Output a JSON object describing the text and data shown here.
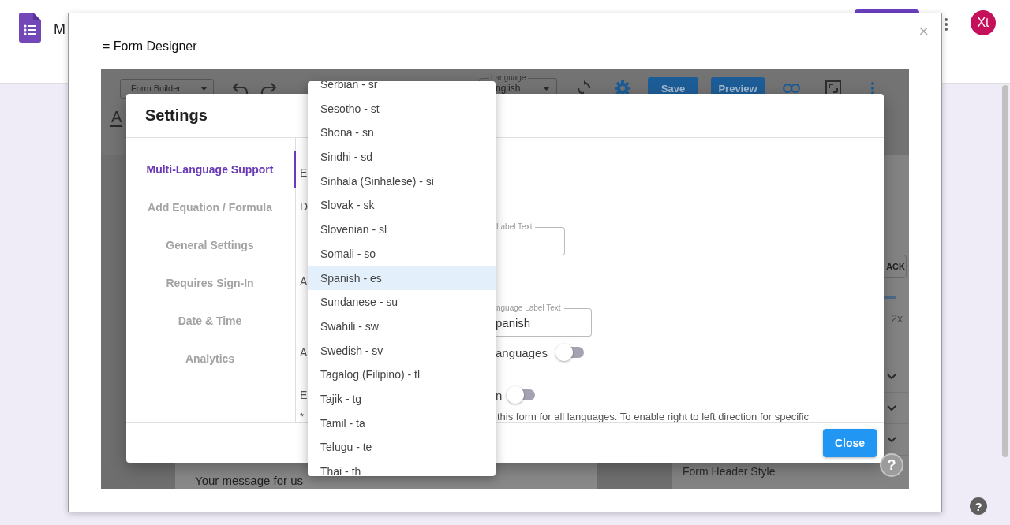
{
  "app_header": {
    "title": "M",
    "avatar": "Xt"
  },
  "page_help": {
    "glyph": "?"
  },
  "designer": {
    "title": "= Form Designer",
    "close_glyph": "×",
    "toolbar": {
      "form_mode": "Form Builder",
      "language_label": "Language",
      "language_value": "nglish",
      "save": "Save",
      "preview": "Preview",
      "format_glyph": "A"
    },
    "side_panel": {
      "button": "ACK",
      "zoom": "2x",
      "section": "Form Header Style"
    },
    "form_card": {
      "message": "Your message for us"
    },
    "help_glyph": "?"
  },
  "settings": {
    "title": "Settings",
    "nav": [
      {
        "label": "Multi-Language Support",
        "selected": true
      },
      {
        "label": "Add Equation / Formula",
        "selected": false
      },
      {
        "label": "General Settings",
        "selected": false
      },
      {
        "label": "Requires Sign-In",
        "selected": false
      },
      {
        "label": "Date & Time",
        "selected": false
      },
      {
        "label": "Analytics",
        "selected": false
      }
    ],
    "rows": [
      {
        "kind": "text",
        "lead": "E"
      },
      {
        "kind": "text",
        "lead": "D"
      },
      {
        "kind": "field",
        "label": "Label Text"
      },
      {
        "kind": "text",
        "lead": "A"
      },
      {
        "kind": "field",
        "label": "nguage Label Text",
        "value": "panish"
      },
      {
        "kind": "toggle",
        "lead": "A",
        "text": "anguages",
        "on": false
      },
      {
        "kind": "toggle",
        "lead": "E",
        "text": "n",
        "on": false
      },
      {
        "kind": "note",
        "lead": "*",
        "text": "this form for all languages. To enable right to left direction for specific"
      }
    ],
    "close": "Close"
  },
  "language_menu": {
    "items": [
      {
        "label": "Serbian - sr",
        "selected": false
      },
      {
        "label": "Sesotho - st",
        "selected": false
      },
      {
        "label": "Shona - sn",
        "selected": false
      },
      {
        "label": "Sindhi - sd",
        "selected": false
      },
      {
        "label": "Sinhala (Sinhalese) - si",
        "selected": false
      },
      {
        "label": "Slovak - sk",
        "selected": false
      },
      {
        "label": "Slovenian - sl",
        "selected": false
      },
      {
        "label": "Somali - so",
        "selected": false
      },
      {
        "label": "Spanish - es",
        "selected": true
      },
      {
        "label": "Sundanese - su",
        "selected": false
      },
      {
        "label": "Swahili - sw",
        "selected": false
      },
      {
        "label": "Swedish - sv",
        "selected": false
      },
      {
        "label": "Tagalog (Filipino) - tl",
        "selected": false
      },
      {
        "label": "Tajik - tg",
        "selected": false
      },
      {
        "label": "Tamil - ta",
        "selected": false
      },
      {
        "label": "Telugu - te",
        "selected": false
      },
      {
        "label": "Thai - th",
        "selected": false
      }
    ]
  }
}
